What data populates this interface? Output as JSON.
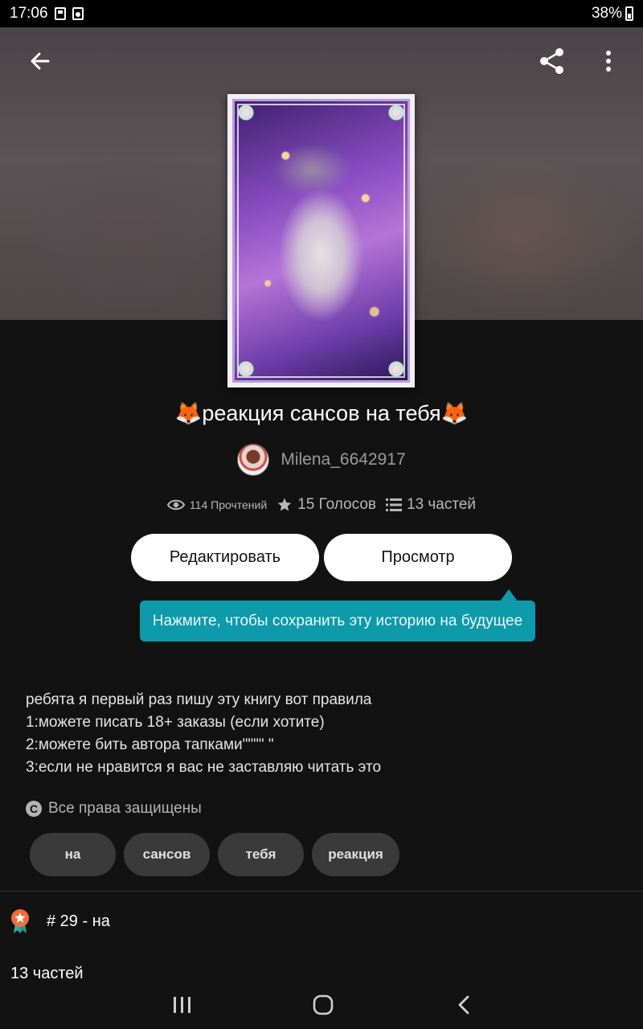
{
  "status_bar": {
    "time": "17:06",
    "battery": "38%",
    "icons": [
      "sd-card-icon",
      "camera-notification-icon",
      "battery-icon"
    ]
  },
  "toolbar": {
    "back_icon": "arrow-left-icon",
    "share_icon": "share-icon",
    "more_icon": "more-vertical-icon"
  },
  "story": {
    "title": "🦊реакция сансов на тебя🦊",
    "author": "Milena_6642917",
    "stats": {
      "reads": "114 Прочтений",
      "votes": "15 Голосов",
      "parts": "13 частей"
    },
    "buttons": {
      "edit": "Редактировать",
      "preview": "Просмотр"
    },
    "tooltip": "Нажмите, чтобы сохранить эту историю на будущее",
    "description": [
      "ребята я первый раз пишу эту книгу вот правила",
      "1:можете писать 18+ заказы (если хотите)",
      "2:можете бить автора тапками\"\"\"\" \"",
      "3:если не нравится я вас не заставляю читать это"
    ],
    "copyright": "Все права защищены",
    "copyright_symbol": "C",
    "tags": [
      "на",
      "сансов",
      "тебя",
      "реакция"
    ],
    "rank": "# 29 - на",
    "parts_heading": "13 частей"
  },
  "colors": {
    "background": "#121212",
    "tooltip": "#0d9aab",
    "button": "#ffffff",
    "tag": "#3a3a3a",
    "rank_badge": "#f26b3a"
  },
  "nav": {
    "recents_icon": "recent-apps-icon",
    "home_icon": "home-icon",
    "back_icon": "nav-back-icon"
  }
}
